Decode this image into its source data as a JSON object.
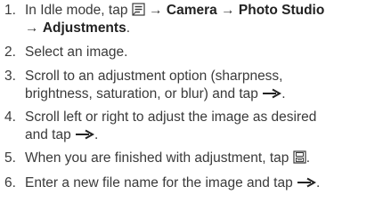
{
  "steps": [
    {
      "number": "1.",
      "prefix": "In Idle mode, tap",
      "icon": "menu-icon",
      "seg1_arrow": "→",
      "bold1": "Camera",
      "seg2_arrow": "→",
      "bold2": "Photo Studio",
      "seg3_arrow": "→",
      "bold3": "Adjustments",
      "suffix": "."
    },
    {
      "number": "2.",
      "text": "Select an image."
    },
    {
      "number": "3.",
      "line1": "Scroll to an adjustment option (sharpness,",
      "line2": "brightness, saturation, or blur) and tap",
      "icon": "next-arrow-icon",
      "suffix": "."
    },
    {
      "number": "4.",
      "line1": "Scroll left or right to adjust the image as desired",
      "line2": "and tap",
      "icon": "next-arrow-icon",
      "suffix": "."
    },
    {
      "number": "5.",
      "text": "When you are finished with adjustment, tap",
      "icon": "save-icon",
      "suffix": "."
    },
    {
      "number": "6.",
      "text": "Enter a new file name for the image and tap",
      "icon": "next-arrow-icon",
      "suffix": "."
    }
  ],
  "colors": {
    "text": "#3a3a3a",
    "bold": "#222222",
    "background": "#ffffff"
  }
}
